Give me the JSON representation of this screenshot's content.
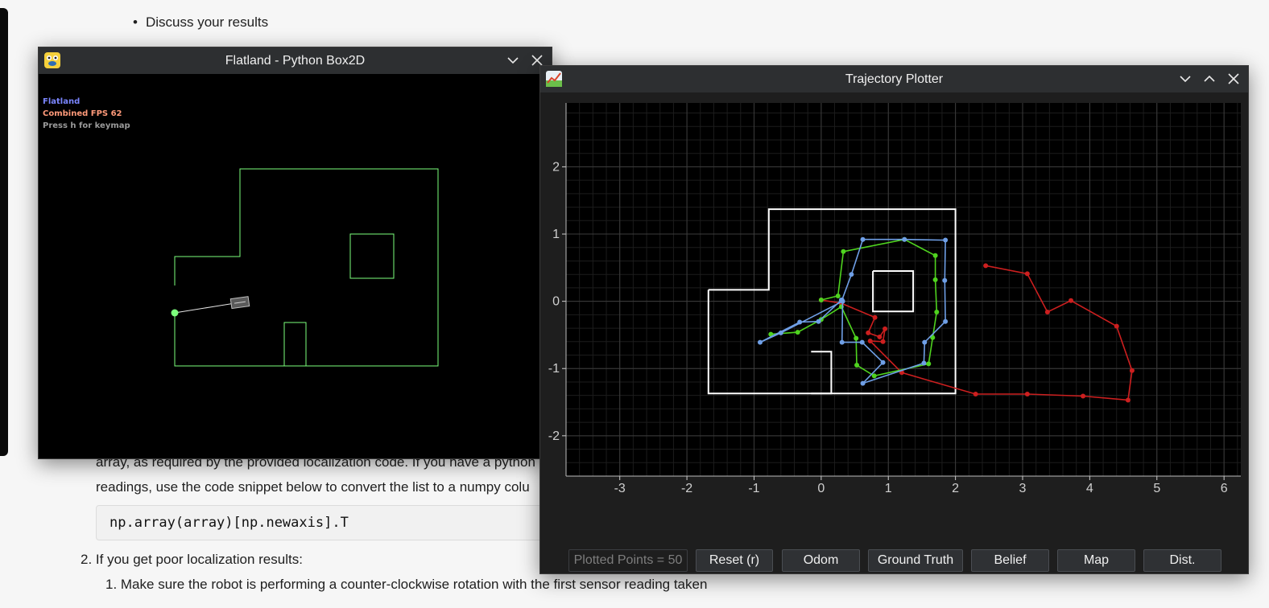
{
  "doc": {
    "bullet_top": "Discuss your results",
    "para_line1": "array, as required by the provided localization code. If you have a python",
    "para_line2": "readings, use the code snippet below to convert the list to a numpy colu",
    "code": "np.array(array)[np.newaxis].T",
    "item2": "2. If you get poor localization results:",
    "item2_1": "1. Make sure the robot is performing a counter-clockwise rotation with the first sensor reading taken"
  },
  "flatland": {
    "title": "Flatland - Python Box2D",
    "hud": {
      "line1": "Flatland",
      "line2": "Combined FPS 62",
      "line3": "Press h for keymap"
    },
    "colors": {
      "hud1": "#7b86ff",
      "hud2": "#ff9a7a",
      "hud3": "#9a9a9a",
      "walls": "#7cff7c"
    }
  },
  "plotter": {
    "title": "Trajectory Plotter",
    "readout": "Plotted Points = 50",
    "buttons": {
      "reset": "Reset (r)",
      "odom": "Odom",
      "ground_truth": "Ground Truth",
      "belief": "Belief",
      "map": "Map",
      "dist": "Dist."
    }
  },
  "chart_data": {
    "type": "line",
    "xlim": [
      -3.8,
      6.25
    ],
    "ylim": [
      -2.6,
      2.95
    ],
    "x_ticks": [
      -3,
      -2,
      -1,
      0,
      1,
      2,
      3,
      4,
      5,
      6
    ],
    "y_ticks": [
      -2,
      -1,
      0,
      1,
      2
    ],
    "grid": true,
    "map_outline": [
      [
        -1.68,
        0.17
      ],
      [
        -0.78,
        0.17
      ],
      [
        -0.78,
        1.37
      ],
      [
        2.0,
        1.37
      ],
      [
        2.0,
        -1.37
      ],
      [
        -1.68,
        -1.37
      ],
      [
        -1.68,
        0.17
      ]
    ],
    "map_obstacles": [
      [
        [
          0.77,
          0.45
        ],
        [
          1.37,
          0.45
        ],
        [
          1.37,
          -0.15
        ],
        [
          0.77,
          -0.15
        ],
        [
          0.77,
          0.45
        ]
      ],
      [
        [
          -0.15,
          -0.75
        ],
        [
          0.15,
          -0.75
        ],
        [
          0.15,
          -1.37
        ],
        [
          -0.15,
          -1.37
        ]
      ]
    ],
    "series": [
      {
        "color": "#cc1f1f",
        "points": [
          [
            2.45,
            0.53
          ],
          [
            3.07,
            0.41
          ],
          [
            3.37,
            -0.16
          ],
          [
            3.72,
            0.01
          ],
          [
            4.4,
            -0.37
          ],
          [
            4.63,
            -1.03
          ],
          [
            4.57,
            -1.47
          ],
          [
            3.9,
            -1.41
          ],
          [
            3.07,
            -1.38
          ],
          [
            2.3,
            -1.38
          ],
          [
            1.2,
            -1.06
          ],
          [
            0.73,
            -0.59
          ],
          [
            0.92,
            -0.6
          ],
          [
            0.95,
            -0.41
          ],
          [
            0.87,
            -0.53
          ],
          [
            0.7,
            -0.47
          ],
          [
            0.8,
            -0.24
          ],
          [
            0.3,
            -0.03
          ],
          [
            0.0,
            0.02
          ]
        ]
      },
      {
        "color": "#4fd31f",
        "points": [
          [
            0.0,
            0.02
          ],
          [
            0.25,
            0.08
          ],
          [
            0.33,
            0.74
          ],
          [
            1.24,
            0.92
          ],
          [
            1.7,
            0.68
          ],
          [
            1.7,
            0.32
          ],
          [
            1.72,
            -0.16
          ],
          [
            1.66,
            -0.54
          ],
          [
            1.6,
            -0.93
          ],
          [
            0.79,
            -1.11
          ],
          [
            0.53,
            -0.95
          ],
          [
            0.52,
            -0.55
          ],
          [
            0.3,
            -0.08
          ],
          [
            0.0,
            -0.27
          ],
          [
            -0.35,
            -0.46
          ],
          [
            -0.75,
            -0.49
          ]
        ]
      },
      {
        "color": "#6f9fe6",
        "points": [
          [
            0.3,
            0.02
          ],
          [
            -0.04,
            -0.3
          ],
          [
            -0.32,
            -0.31
          ],
          [
            -0.91,
            -0.61
          ],
          [
            -0.6,
            -0.47
          ],
          [
            0.32,
            0.0
          ],
          [
            0.31,
            -0.61
          ],
          [
            0.61,
            -0.61
          ],
          [
            0.92,
            -0.91
          ],
          [
            0.62,
            -1.22
          ],
          [
            1.53,
            -0.92
          ],
          [
            1.54,
            -0.61
          ],
          [
            1.85,
            -0.3
          ],
          [
            1.84,
            0.31
          ],
          [
            1.85,
            0.91
          ],
          [
            1.24,
            0.92
          ],
          [
            0.62,
            0.92
          ],
          [
            0.45,
            0.4
          ],
          [
            0.31,
            0.02
          ]
        ]
      }
    ]
  }
}
